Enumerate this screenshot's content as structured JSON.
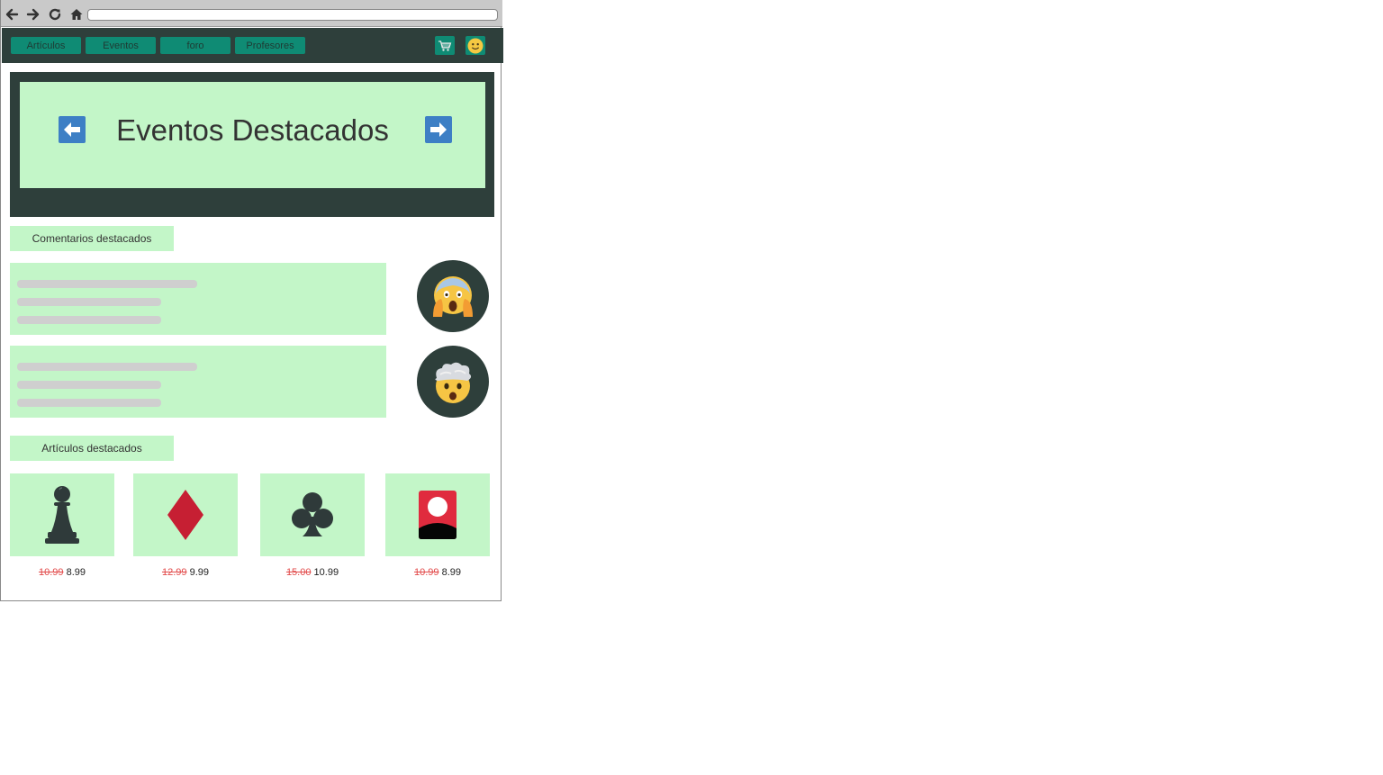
{
  "browser": {
    "icons": [
      "back-arrow-icon",
      "forward-arrow-icon",
      "reload-icon",
      "home-icon"
    ],
    "address_value": ""
  },
  "nav": {
    "tabs": [
      "Artículos",
      "Eventos",
      "foro",
      "Profesores"
    ],
    "icons": [
      "cart-icon",
      "smiley-face-icon"
    ]
  },
  "carousel": {
    "title": "Eventos Destacados"
  },
  "comments": {
    "heading": "Comentarios destacados",
    "avatars": [
      "screaming-face-icon",
      "exploding-head-icon"
    ]
  },
  "articles": {
    "heading": "Artículos destacados",
    "items": [
      {
        "icon": "chess-pawn-icon",
        "old_price": "10.99",
        "new_price": "8.99"
      },
      {
        "icon": "diamond-suit-icon",
        "old_price": "12.99",
        "new_price": "9.99"
      },
      {
        "icon": "club-suit-icon",
        "old_price": "15.00",
        "new_price": "10.99"
      },
      {
        "icon": "flower-playing-card-icon",
        "old_price": "10.99",
        "new_price": "8.99"
      }
    ]
  },
  "colors": {
    "dark": "#2e3f3b",
    "mint": "#c3f6c8",
    "teal": "#0f8b74",
    "accent_blue": "#3d7fc5",
    "strike_red": "#e24a4a"
  }
}
